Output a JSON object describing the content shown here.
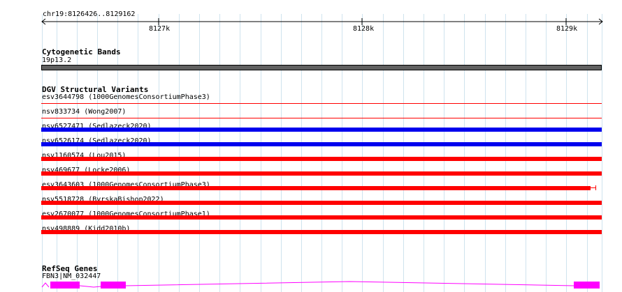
{
  "ruler": {
    "position_label": "chr19:8126426..8129162",
    "ticks": [
      "8127k",
      "8128k",
      "8129k"
    ]
  },
  "cytoband": {
    "title": "Cytogenetic Bands",
    "band_label": "19p13.2",
    "band_color": "#606060"
  },
  "dgv": {
    "title": "DGV Structural Variants",
    "gain_color": "#0000ee",
    "loss_color": "#ff0000",
    "variants": [
      {
        "label": "esv3644798 (1000GenomesConsortiumPhase3)",
        "type": "loss",
        "style": "thin"
      },
      {
        "label": "nsv833734 (Wong2007)",
        "type": "loss",
        "style": "thin"
      },
      {
        "label": "nsv6527471 (Sedlazeck2020)",
        "type": "gain",
        "style": "bar"
      },
      {
        "label": "nsv6526174 (Sedlazeck2020)",
        "type": "gain",
        "style": "bar"
      },
      {
        "label": "nsv1160574 (Lou2015)",
        "type": "loss",
        "style": "bar"
      },
      {
        "label": "nsv469677 (Locke2006)",
        "type": "loss",
        "style": "bar"
      },
      {
        "label": "esv3643603 (1000GenomesConsortiumPhase3)",
        "type": "loss",
        "style": "bar-end"
      },
      {
        "label": "nsv5518728 (ByrskaBishop2022)",
        "type": "loss",
        "style": "bar"
      },
      {
        "label": "esv2670077 (1000GenomesConsortiumPhase1)",
        "type": "loss",
        "style": "bar"
      },
      {
        "label": "nsv498889 (Kidd2010b)",
        "type": "loss",
        "style": "bar"
      }
    ]
  },
  "refseq": {
    "title": "RefSeq Genes",
    "gene_label": "FBN3|NM_032447",
    "exon_color": "#ff00ff"
  }
}
